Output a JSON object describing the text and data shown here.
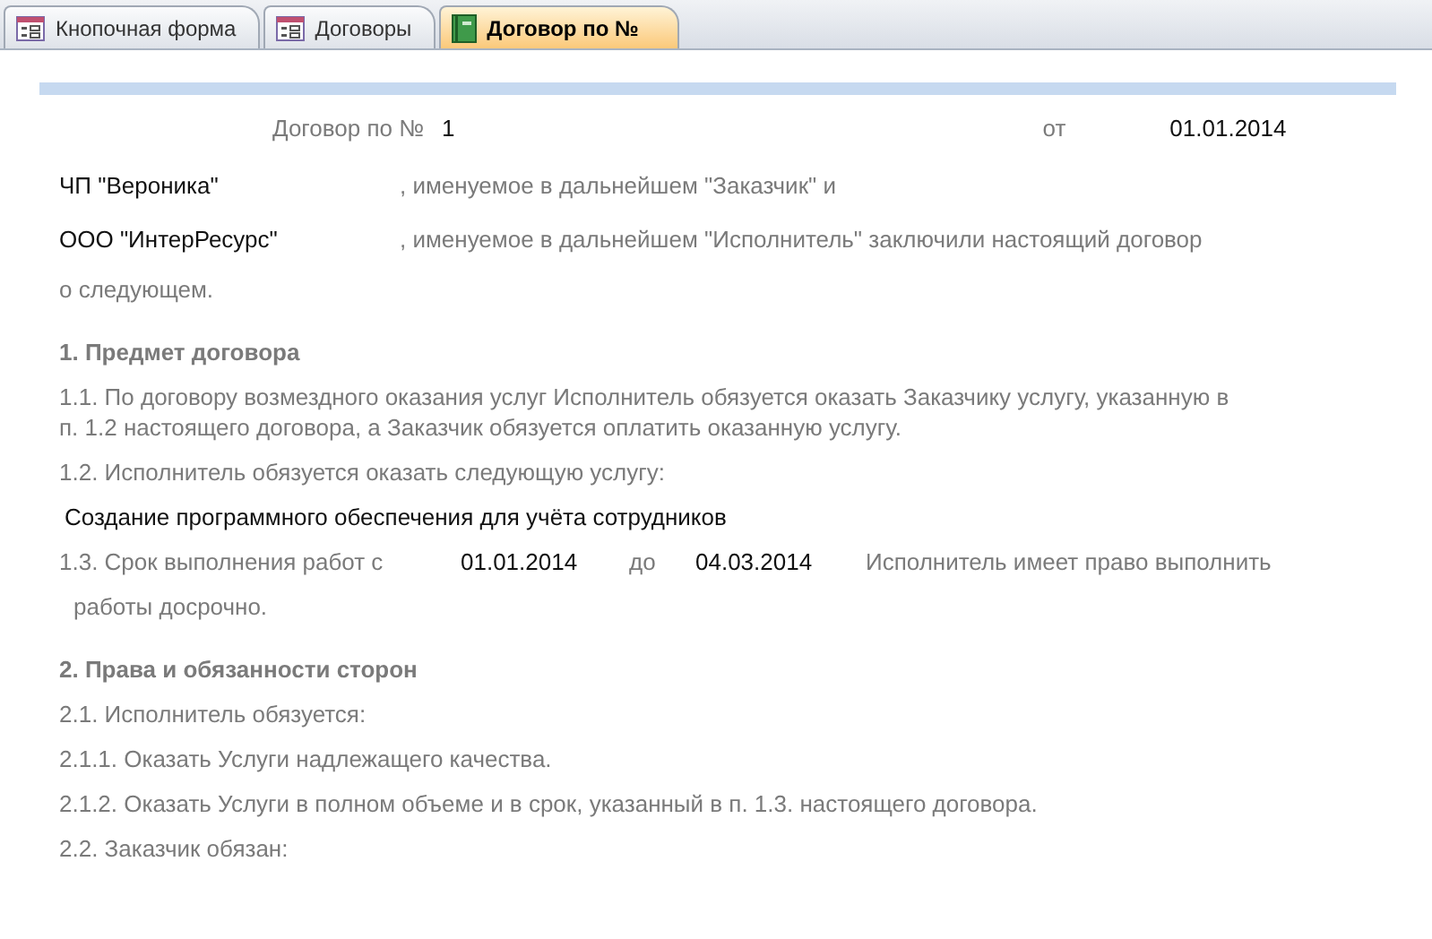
{
  "tabs": [
    {
      "label": "Кнопочная форма",
      "kind": "form",
      "selected": false
    },
    {
      "label": "Договоры",
      "kind": "form",
      "selected": false
    },
    {
      "label": "Договор по №",
      "kind": "book",
      "selected": true
    }
  ],
  "header": {
    "label": "Договор по №",
    "number": "1",
    "date_label": "от",
    "date": "01.01.2014"
  },
  "parties": [
    {
      "name": "ЧП \"Вероника\"",
      "text": ", именуемое в дальнейшем \"Заказчик\" и"
    },
    {
      "name": "ООО \"ИнтерРесурс\"",
      "text": ", именуемое в дальнейшем \"Исполнитель\" заключили настоящий договор"
    }
  ],
  "blocks": [
    {
      "kind": "para",
      "text": "о следующем."
    },
    {
      "kind": "heading",
      "text": "1. Предмет договора"
    },
    {
      "kind": "para",
      "text": "1.1. По договору возмездного оказания услуг Исполнитель обязуется оказать Заказчику услугу, указанную в п. 1.2 настоящего договора, а Заказчик обязуется оплатить оказанную услугу."
    },
    {
      "kind": "para",
      "text": "1.2. Исполнитель обязуется оказать следующую услугу:"
    },
    {
      "kind": "value",
      "text": "Создание программного обеспечения для учёта сотрудников"
    },
    {
      "kind": "terms",
      "label": "1.3. Срок выполнения работ с",
      "start": "01.01.2014",
      "to_label": "до",
      "end": "04.03.2014",
      "text": "Исполнитель имеет право выполнить"
    },
    {
      "kind": "indent",
      "text": "работы досрочно."
    },
    {
      "kind": "heading",
      "text": "2. Права и обязанности сторон"
    },
    {
      "kind": "para",
      "text": "2.1. Исполнитель обязуется:"
    },
    {
      "kind": "para",
      "text": "2.1.1. Оказать Услуги надлежащего качества."
    },
    {
      "kind": "para",
      "text": "2.1.2. Оказать Услуги в полном объеме и в срок, указанный в п. 1.3. настоящего договора."
    },
    {
      "kind": "para",
      "text": "2.2. Заказчик обязан:"
    }
  ]
}
